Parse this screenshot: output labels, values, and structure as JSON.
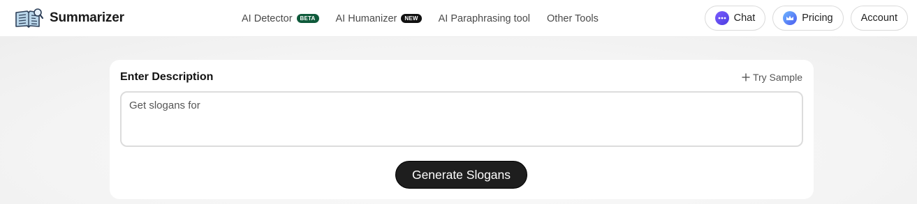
{
  "brand": {
    "name": "Summarizer",
    "logo_icon": "open-book-magnifier-icon"
  },
  "nav": {
    "items": [
      {
        "label": "AI Detector",
        "badge": "BETA",
        "badge_color": "#0f5a3b"
      },
      {
        "label": "AI Humanizer",
        "badge": "NEW",
        "badge_color": "#111111"
      },
      {
        "label": "AI Paraphrasing tool"
      },
      {
        "label": "Other Tools"
      }
    ]
  },
  "actions": {
    "chat": {
      "label": "Chat",
      "icon": "chat-bubble-icon"
    },
    "pricing": {
      "label": "Pricing",
      "icon": "crown-icon"
    },
    "account": {
      "label": "Account"
    }
  },
  "form": {
    "title": "Enter Description",
    "try_sample": "Try Sample",
    "description_value": "Get slogans for",
    "generate_label": "Generate Slogans"
  },
  "colors": {
    "accent_dark": "#1e1e1e",
    "chat_icon": "#5b47ee",
    "pricing_icon": "#4b8af0"
  }
}
